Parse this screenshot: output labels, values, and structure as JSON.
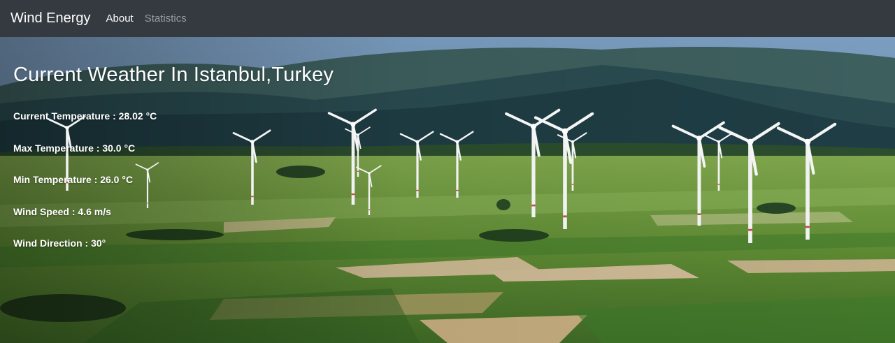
{
  "navbar": {
    "brand": "Wind Energy",
    "links": [
      {
        "label": "About",
        "state": "active"
      },
      {
        "label": "Statistics",
        "state": "inactive"
      }
    ]
  },
  "weather": {
    "heading": "Current Weather In Istanbul,Turkey",
    "current_temperature": "Current Temperature : 28.02 °C",
    "max_temperature": "Max Temperature : 30.0 °C",
    "min_temperature": "Min Temperature : 26.0 °C",
    "wind_speed": "Wind Speed : 4.6 m/s",
    "wind_direction": "Wind Direction : 30°"
  },
  "colors": {
    "navbar_bg": "#343a40",
    "sky": "#6c8eb0",
    "hills_dark": "#1c3c46",
    "fields": "#5d8a35"
  }
}
